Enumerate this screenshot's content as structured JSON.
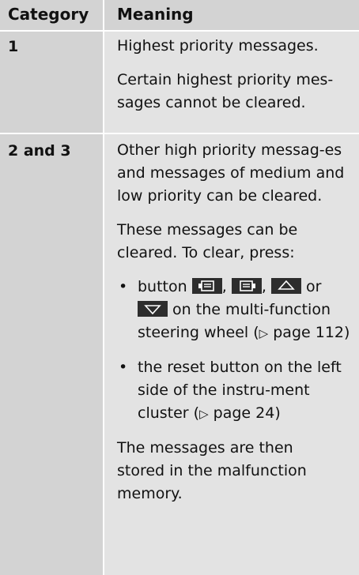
{
  "table": {
    "header": {
      "category": "Category",
      "meaning": "Meaning"
    },
    "row1": {
      "category": "1",
      "p1": "Highest priority messages.",
      "p2": "Certain highest priority mes-sages cannot be cleared."
    },
    "row2": {
      "category": "2 and 3",
      "p1": "Other high priority messag-es and messages of medium and low priority can be cleared.",
      "p2": "These messages can be cleared. To clear, press:",
      "bullet1": {
        "pre": "button",
        "sep1": ",",
        "sep2": ",",
        "or": "or",
        "post": "on the multi-function steering wheel",
        "ref": "page 112"
      },
      "bullet2": {
        "text": "the reset button on the left side of the instru-ment cluster",
        "ref": "page 24"
      },
      "p3": "The messages are then stored in the malfunction memory."
    }
  },
  "icons": [
    "display-back-button-icon",
    "display-forward-button-icon",
    "up-arrow-button-icon",
    "down-arrow-button-icon"
  ],
  "colors": {
    "header_cat_bg": "#d3d3d3",
    "meaning_bg": "#e3e3e3",
    "button_bg": "#2d2d2d"
  }
}
